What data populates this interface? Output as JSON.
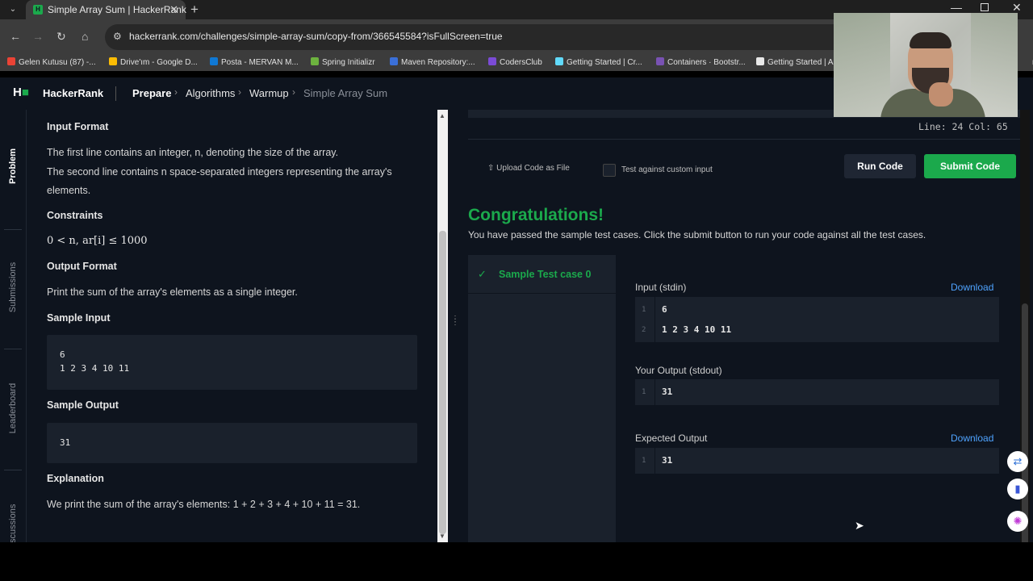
{
  "browser": {
    "tab_title": "Simple Array Sum | HackerRank",
    "tab_favicon": "H",
    "url": "hackerrank.com/challenges/simple-array-sum/copy-from/366545584?isFullScreen=true",
    "bookmarks": [
      {
        "label": "Gelen Kutusu (87) -...",
        "color": "#ea4335"
      },
      {
        "label": "Drive'ım - Google D...",
        "color": "#fbbc04"
      },
      {
        "label": "Posta - MERVAN M...",
        "color": "#0f78d4"
      },
      {
        "label": "Spring Initializr",
        "color": "#6db33f"
      },
      {
        "label": "Maven Repository:...",
        "color": "#3a6fd8"
      },
      {
        "label": "CodersClub",
        "color": "#7b4bd6"
      },
      {
        "label": "Getting Started | Cr...",
        "color": "#61dafb"
      },
      {
        "label": "Containers · Bootstr...",
        "color": "#7952b3"
      },
      {
        "label": "Getting Started | A",
        "color": "#e8e8e8"
      },
      {
        "label": "ri",
        "color": "#3c3c3c"
      }
    ]
  },
  "header": {
    "logo": "H",
    "brand": "HackerRank",
    "breadcrumbs": [
      "Prepare",
      "Algorithms",
      "Warmup",
      "Simple Array Sum"
    ]
  },
  "vtabs": [
    "Problem",
    "Submissions",
    "Leaderboard",
    "Discussions"
  ],
  "problem": {
    "input_format_title": "Input Format",
    "input_line1": "The first line contains an integer, n, denoting the size of the array.",
    "input_line2": "The second line contains n space-separated integers representing the array's",
    "input_line3": "elements.",
    "constraints_title": "Constraints",
    "constraint": "0 < n, ar[i] ≤ 1000",
    "output_format_title": "Output Format",
    "output_line": "Print the sum of the array's elements as a single integer.",
    "sample_input_title": "Sample Input",
    "sample_input_lines": [
      "6",
      "1 2 3 4 10 11"
    ],
    "sample_output_title": "Sample Output",
    "sample_output": "31",
    "explanation_title": "Explanation",
    "explanation_text": "We print the sum of the array's elements: 1 + 2 + 3 + 4 + 10 + 11 = 31."
  },
  "editor": {
    "line_col": "Line: 24 Col: 65",
    "upload_label": "Upload Code as File",
    "custom_input_label": "Test against custom input",
    "run_label": "Run Code",
    "submit_label": "Submit Code"
  },
  "result": {
    "title": "Congratulations!",
    "message": "You have passed the sample test cases. Click the submit button to run your code against all the test cases.",
    "testcase_label": "Sample Test case 0",
    "input_label": "Input (stdin)",
    "download_label": "Download",
    "input_lines": [
      {
        "n": "1",
        "v": "6"
      },
      {
        "n": "2",
        "v": "1 2 3 4 10 11"
      }
    ],
    "your_output_label": "Your Output (stdout)",
    "your_output_lines": [
      {
        "n": "1",
        "v": "31"
      }
    ],
    "expected_label": "Expected Output",
    "expected_lines": [
      {
        "n": "1",
        "v": "31"
      }
    ]
  },
  "colors": {
    "accent_green": "#1ba94c",
    "link_blue": "#4fa3ff",
    "background": "#0e141e"
  }
}
